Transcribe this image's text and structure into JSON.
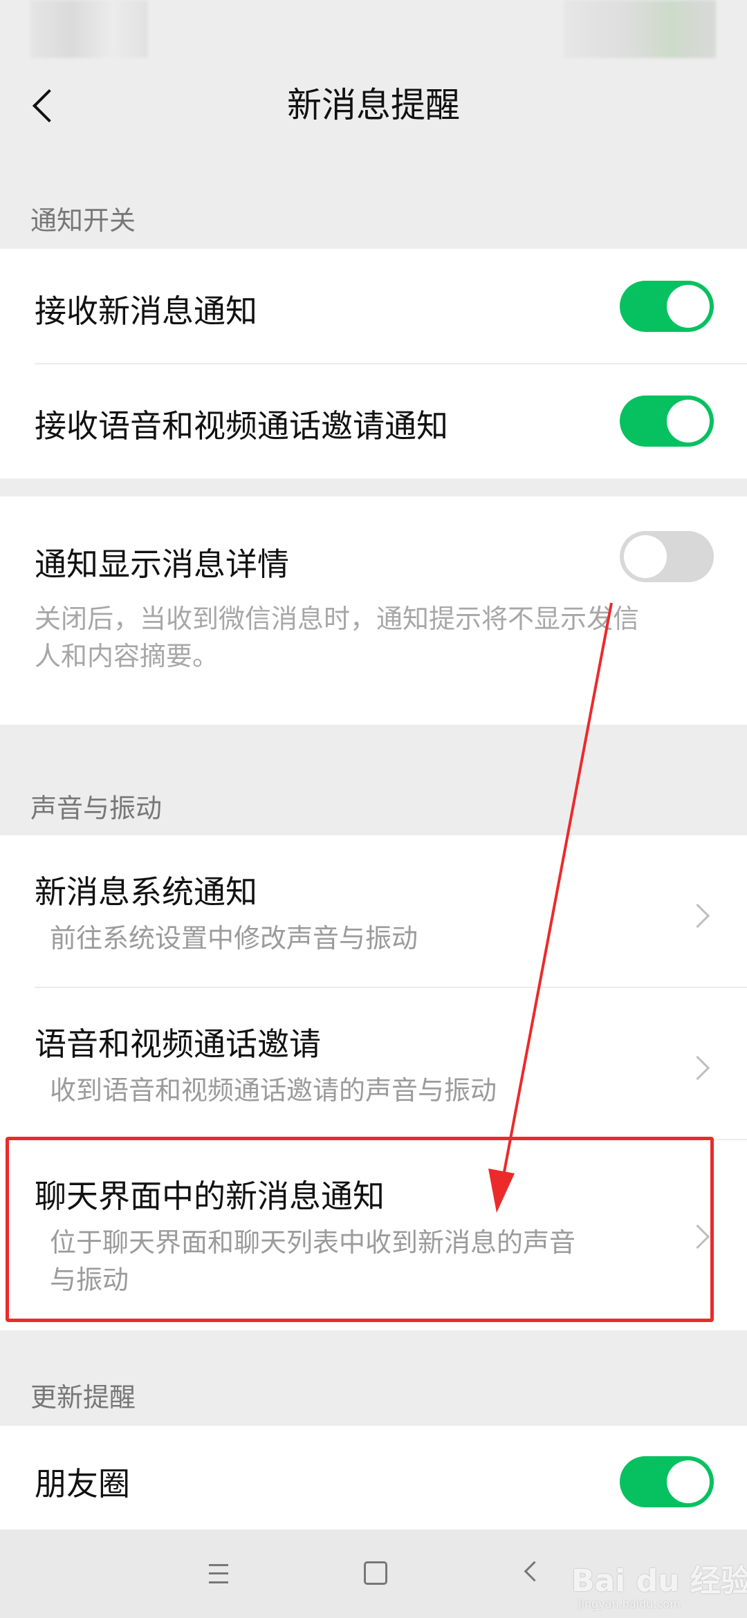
{
  "nav": {
    "title": "新消息提醒"
  },
  "section_notify": {
    "header": "通知开关",
    "items": [
      {
        "label": "接收新消息通知",
        "on": true
      },
      {
        "label": "接收语音和视频通话邀请通知",
        "on": true
      }
    ]
  },
  "detail": {
    "label": "通知显示消息详情",
    "on": false,
    "desc_line1": "关闭后，当收到微信消息时，通知提示将不显示发信",
    "desc_line2": "人和内容摘要。"
  },
  "section_sound": {
    "header": "声音与振动",
    "items": [
      {
        "label": "新消息系统通知",
        "sub_line1": "前往系统设置中修改声音与振动",
        "sub_line2": ""
      },
      {
        "label": "语音和视频通话邀请",
        "sub_line1": "收到语音和视频通话邀请的声音与振动",
        "sub_line2": ""
      },
      {
        "label": "聊天界面中的新消息通知",
        "sub_line1": "位于聊天界面和聊天列表中收到新消息的声音",
        "sub_line2": "与振动"
      }
    ]
  },
  "section_update": {
    "header": "更新提醒",
    "items": [
      {
        "label": "朋友圈",
        "on": true
      }
    ]
  },
  "watermark": {
    "text": "Bai du 经验",
    "sub": "jingyan.baidu.com"
  },
  "colors": {
    "background": "#ededed",
    "card": "#ffffff",
    "toggle_on": "#07c160",
    "toggle_off": "#d8d8d8",
    "annotation": "#ec2a2a"
  }
}
